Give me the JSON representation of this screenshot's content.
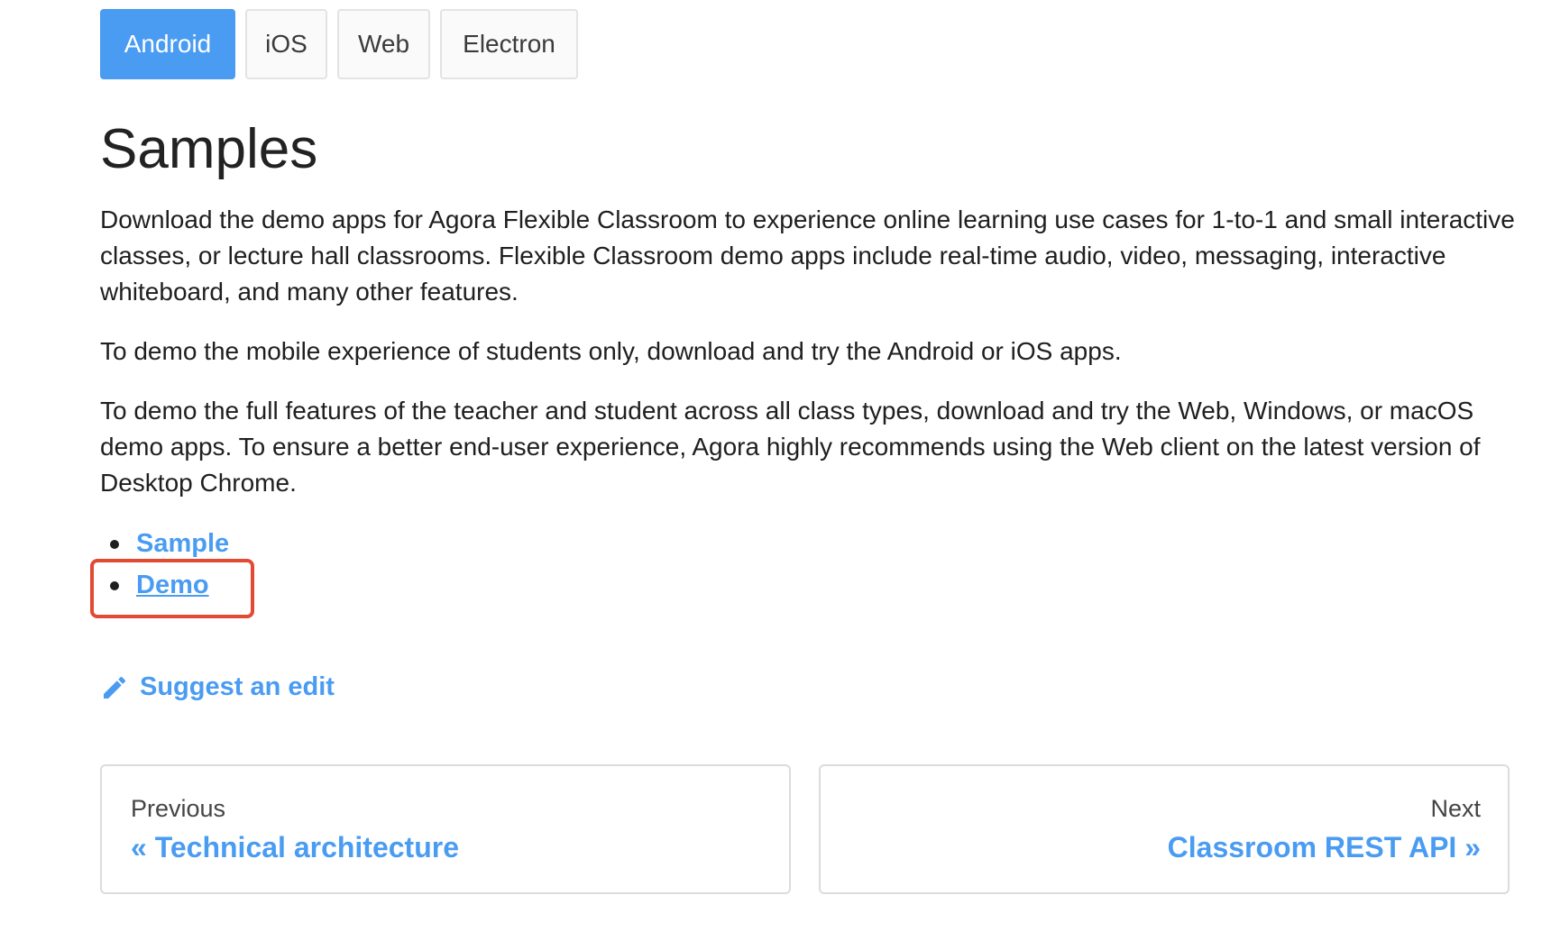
{
  "tabs": [
    {
      "label": "Android",
      "active": true
    },
    {
      "label": "iOS",
      "active": false
    },
    {
      "label": "Web",
      "active": false
    },
    {
      "label": "Electron",
      "active": false
    }
  ],
  "heading": "Samples",
  "paragraphs": [
    "Download the demo apps for Agora Flexible Classroom to experience online learning use cases for 1-to-1 and small interactive classes, or lecture hall classrooms. Flexible Classroom demo apps include real-time audio, video, messaging, interactive whiteboard, and many other features.",
    "To demo the mobile experience of students only, download and try the Android or iOS apps.",
    "To demo the full features of the teacher and student across all class types, download and try the Web, Windows, or macOS demo apps. To ensure a better end-user experience, Agora highly recommends using the Web client on the latest version of Desktop Chrome."
  ],
  "links": [
    {
      "label": "Sample"
    },
    {
      "label": "Demo"
    }
  ],
  "suggest_edit": {
    "label": "Suggest an edit",
    "icon": "pencil-icon"
  },
  "pagination": {
    "previous": {
      "sub": "Previous",
      "title": "« Technical architecture"
    },
    "next": {
      "sub": "Next",
      "title": "Classroom REST API »"
    }
  },
  "colors": {
    "accent": "#4a9cf2",
    "highlight": "#e24a33"
  }
}
